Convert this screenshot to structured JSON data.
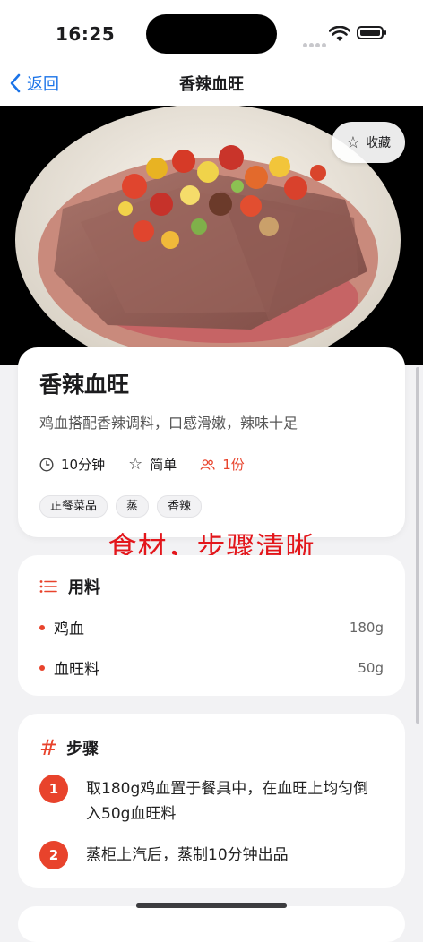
{
  "status_bar": {
    "time": "16:25"
  },
  "nav": {
    "back_label": "返回",
    "title": "香辣血旺"
  },
  "hero": {
    "favorite_label": "收藏"
  },
  "recipe": {
    "title": "香辣血旺",
    "description": "鸡血搭配香辣调料，口感滑嫩，辣味十足",
    "time": "10分钟",
    "difficulty": "简单",
    "servings": "1份",
    "tags": [
      "正餐菜品",
      "蒸",
      "香辣"
    ]
  },
  "annotation": "食材，步骤清晰",
  "ingredients": {
    "title": "用料",
    "items": [
      {
        "name": "鸡血",
        "amount": "180g"
      },
      {
        "name": "血旺料",
        "amount": "50g"
      }
    ]
  },
  "steps": {
    "title": "步骤",
    "items": [
      {
        "num": "1",
        "text": "取180g鸡血置于餐具中，在血旺上均匀倒入50g血旺料"
      },
      {
        "num": "2",
        "text": "蒸柜上汽后，蒸制10分钟出品"
      }
    ]
  },
  "colors": {
    "accent": "#e8432c",
    "link": "#1a73e8",
    "annotation": "#e3161b"
  }
}
